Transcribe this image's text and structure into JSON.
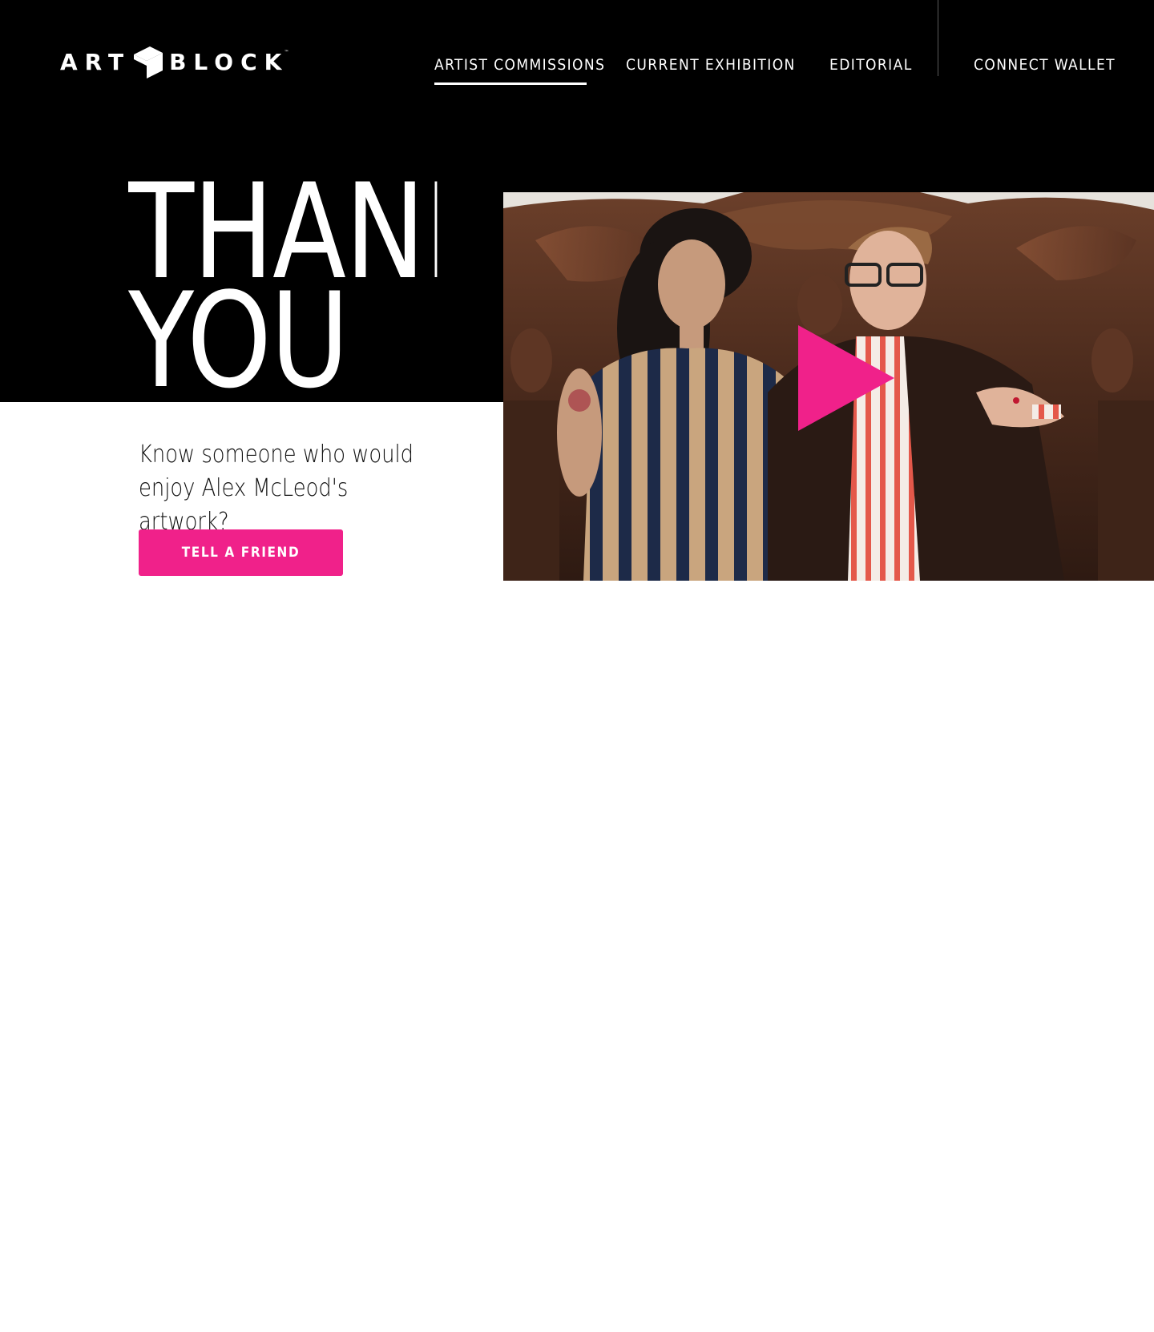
{
  "brand": {
    "logo_left": "ART",
    "logo_right": "BLOCK",
    "logo_tm": "™"
  },
  "nav": {
    "items": [
      {
        "label": "ARTIST COMMISSIONS",
        "active": true
      },
      {
        "label": "CURRENT EXHIBITION",
        "active": false
      },
      {
        "label": "EDITORIAL",
        "active": false
      },
      {
        "label": "CONNECT WALLET",
        "active": false
      }
    ]
  },
  "hero": {
    "headline_line1": "THANK",
    "headline_line2": "YOU",
    "subtext": "Know someone who would enjoy Alex McLeod's artwork?",
    "cta_label": "TELL A FRIEND"
  },
  "video": {
    "play_icon": "play-icon"
  },
  "colors": {
    "background_dark": "#000000",
    "background_light": "#ffffff",
    "accent": "#f0218a",
    "text_dark": "#111111",
    "text_light": "#ffffff"
  }
}
